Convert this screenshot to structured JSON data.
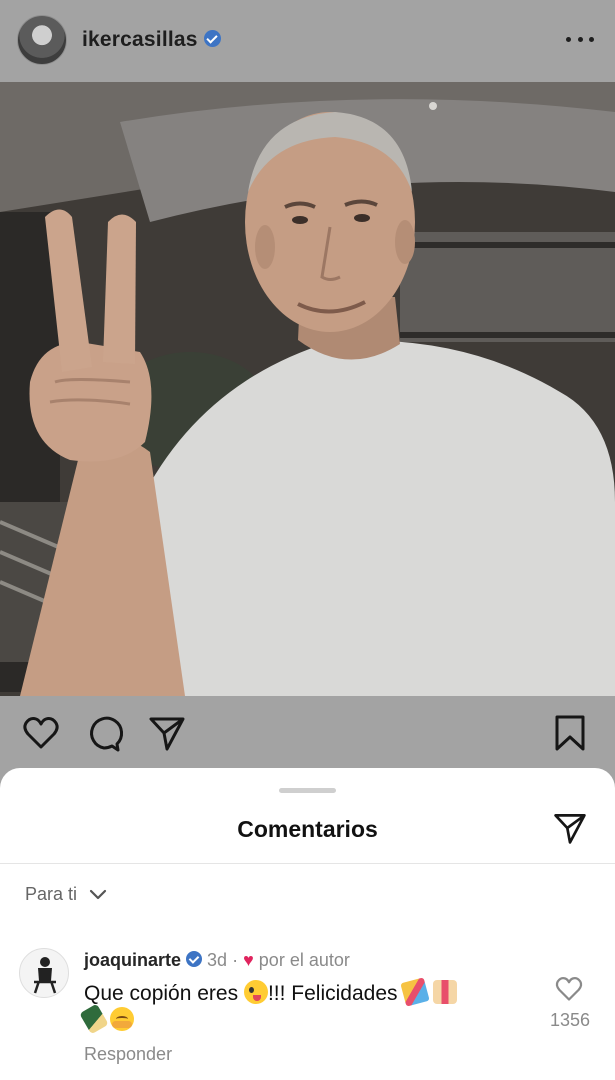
{
  "post": {
    "username": "ikercasillas",
    "verified": true,
    "more_icon": "more-horizontal-icon"
  },
  "actions": {
    "like_icon": "heart-outline-icon",
    "comment_icon": "comment-bubble-icon",
    "share_icon": "paper-plane-icon",
    "save_icon": "bookmark-icon"
  },
  "comments_sheet": {
    "title": "Comentarios",
    "filter_label": "Para ti",
    "comments": [
      {
        "username": "joaquinarte",
        "verified": true,
        "time": "3d",
        "separator": "·",
        "liked_by_author_label": "por el autor",
        "text_part1": "Que copión eres",
        "text_part2": "!!! Felicidades",
        "reply_label": "Responder",
        "like_count": "1356"
      }
    ]
  },
  "colors": {
    "dim_overlay": "#a3a3a3",
    "verified_blue": "#3d74c4",
    "author_heart": "#e0245e",
    "sheet_bg": "#ffffff"
  }
}
